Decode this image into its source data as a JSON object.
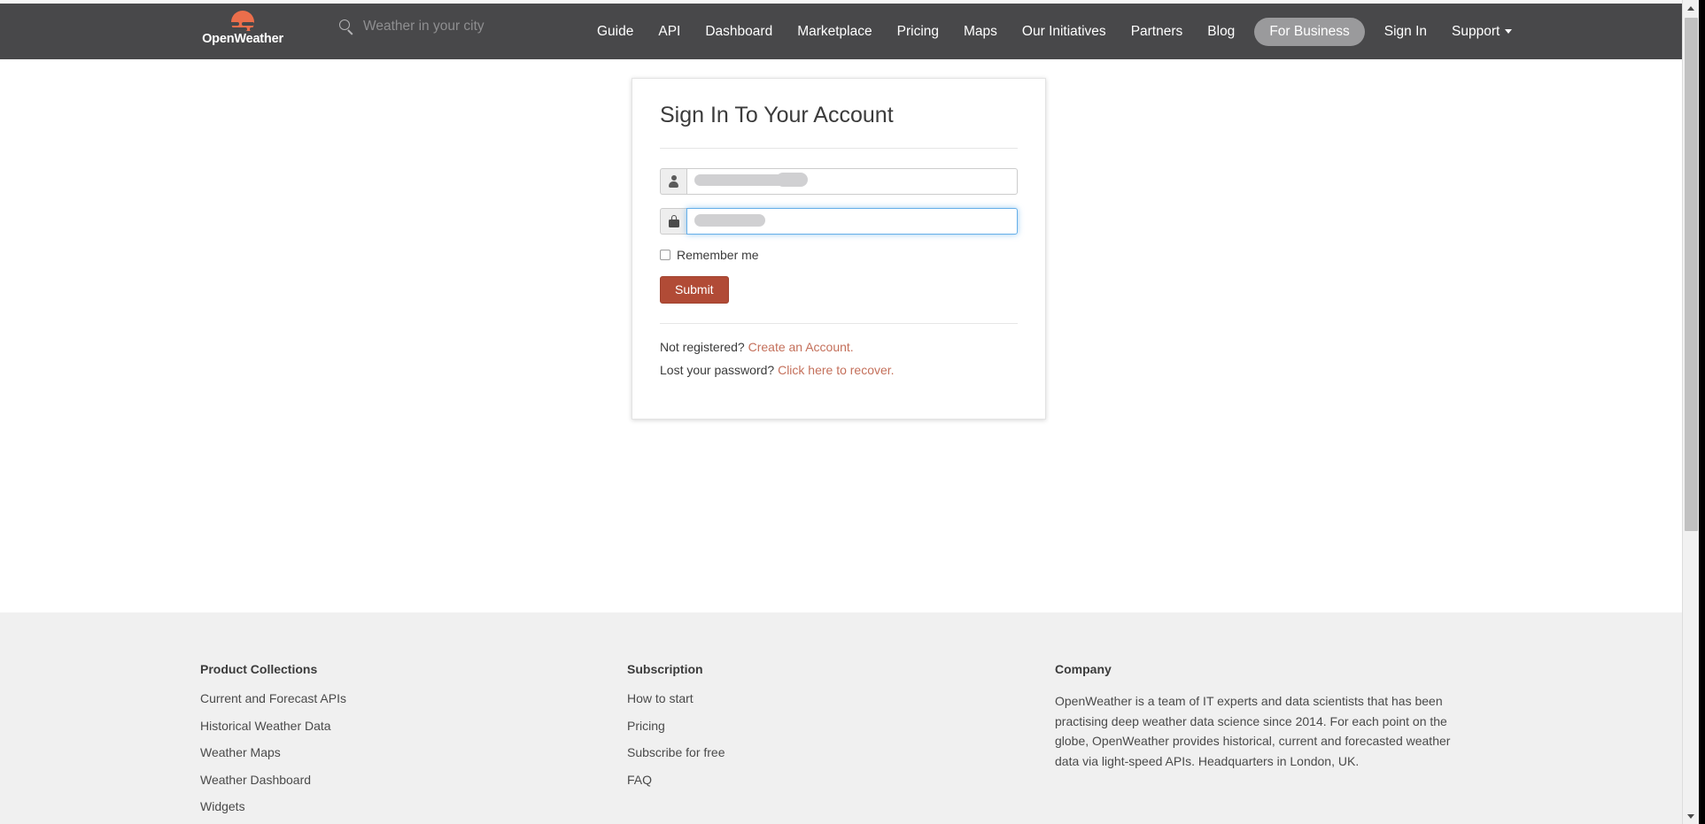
{
  "header": {
    "logo": {
      "name": "OpenWeather",
      "icon": "sun-cloud-logo-icon",
      "color": "#eb6e4b"
    },
    "search": {
      "placeholder": "Weather in your city",
      "value": "",
      "icon": "search-icon"
    },
    "nav_items": [
      {
        "label": "Guide",
        "style": "plain"
      },
      {
        "label": "API",
        "style": "plain"
      },
      {
        "label": "Dashboard",
        "style": "plain"
      },
      {
        "label": "Marketplace",
        "style": "plain"
      },
      {
        "label": "Pricing",
        "style": "plain"
      },
      {
        "label": "Maps",
        "style": "plain"
      },
      {
        "label": "Our Initiatives",
        "style": "plain"
      },
      {
        "label": "Partners",
        "style": "plain"
      },
      {
        "label": "Blog",
        "style": "plain"
      },
      {
        "label": "For Business",
        "style": "pill"
      },
      {
        "label": "Sign In",
        "style": "plain"
      },
      {
        "label": "Support",
        "style": "caret"
      }
    ],
    "background_color": "#48484a",
    "pill_color": "#9a9a9c"
  },
  "signin": {
    "title": "Sign In To Your Account",
    "username": {
      "icon": "person-icon",
      "value": "",
      "placeholder": "",
      "redacted": true
    },
    "password": {
      "icon": "lock-icon",
      "value": "",
      "placeholder": "",
      "redacted": true,
      "focused": true
    },
    "remember_me_label": "Remember me",
    "remember_me_checked": false,
    "submit_label": "Submit",
    "submit_color": "#b14b36",
    "not_registered_text": "Not registered?",
    "create_account_link": "Create an Account.",
    "lost_password_text": "Lost your password?",
    "recover_link": "Click here to recover.",
    "link_color": "#c4705b"
  },
  "footer": {
    "columns": [
      {
        "heading": "Product Collections",
        "links": [
          "Current and Forecast APIs",
          "Historical Weather Data",
          "Weather Maps",
          "Weather Dashboard",
          "Widgets"
        ]
      },
      {
        "heading": "Subscription",
        "links": [
          "How to start",
          "Pricing",
          "Subscribe for free",
          "FAQ"
        ]
      }
    ],
    "company": {
      "heading": "Company",
      "text": "OpenWeather is a team of IT experts and data scientists that has been practising deep weather data science since 2014. For each point on the globe, OpenWeather provides historical, current and forecasted weather data via light-speed APIs. Headquarters in London, UK."
    },
    "background_color": "#f0f0f0"
  },
  "scrollbar": {
    "up_arrow": "chevron-up-icon",
    "down_arrow": "chevron-down-icon",
    "thumb_position": "top"
  }
}
